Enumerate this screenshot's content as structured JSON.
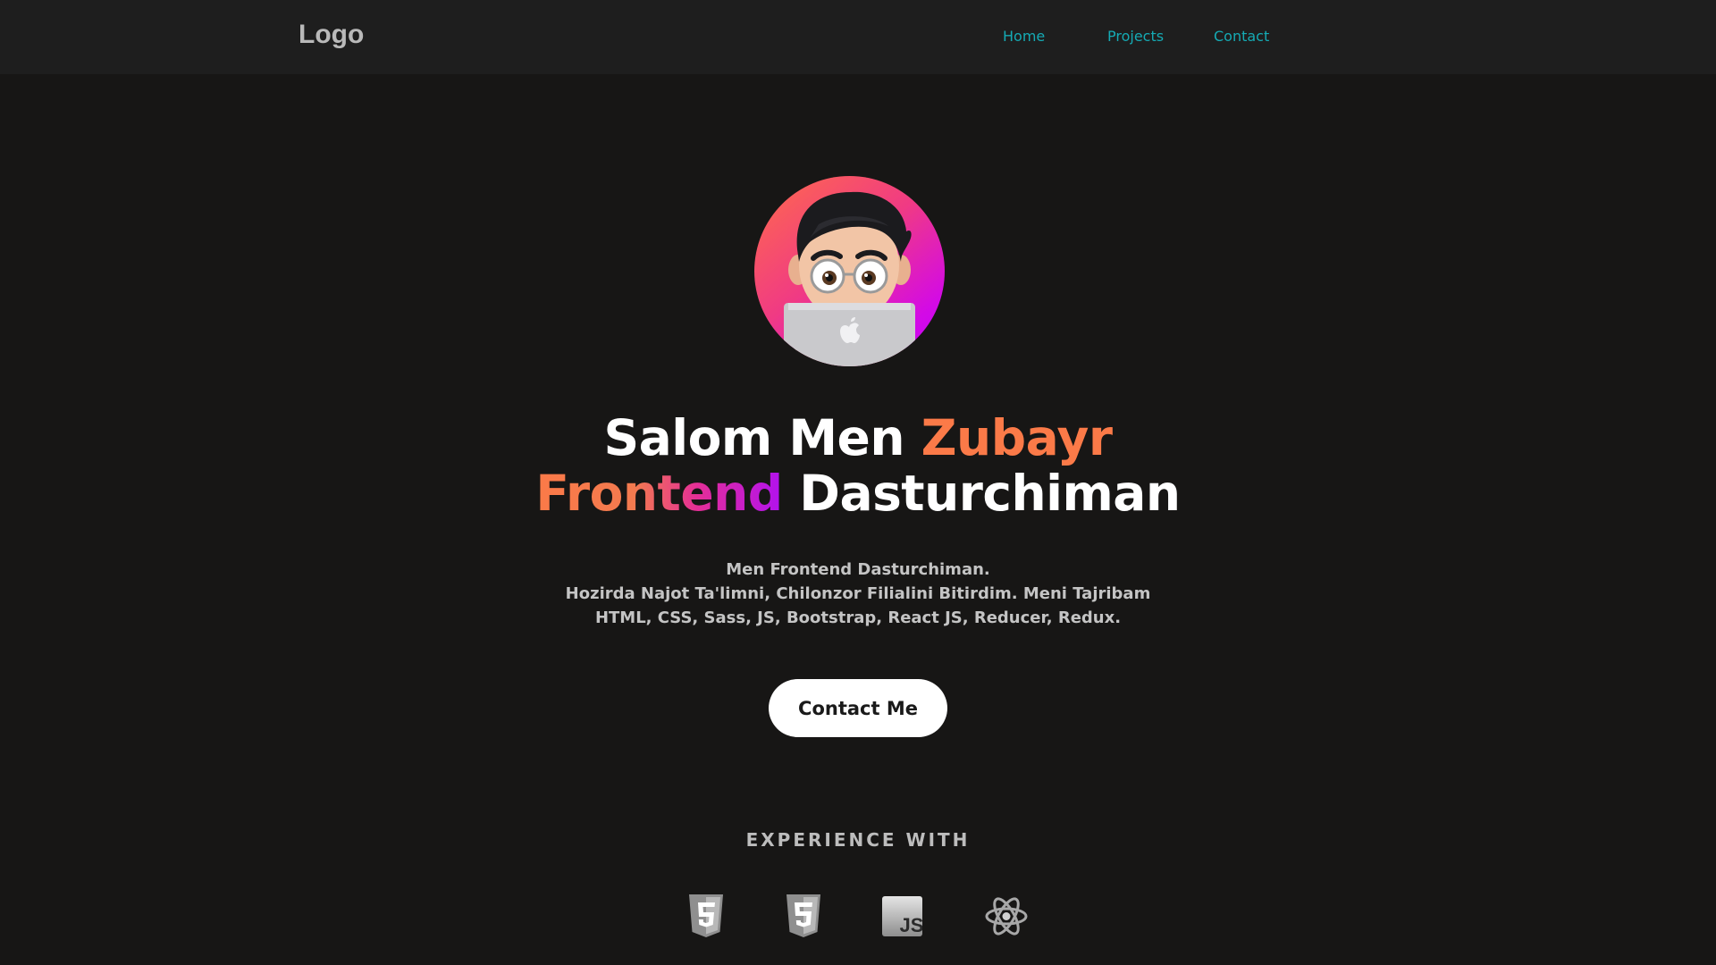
{
  "nav": {
    "logo": "Logo",
    "links": [
      {
        "label": "Home"
      },
      {
        "label": "Projects"
      },
      {
        "label": "Contact"
      }
    ],
    "link_color": "#15aab4"
  },
  "hero": {
    "avatar_icon": "memoji-avatar-laptop",
    "title_line1_a": "Salom Men ",
    "title_line1_b": "Zubayr",
    "title_line2_a": "Frontend",
    "title_line2_b": " Dasturchiman",
    "accent_color": "#fb7a48",
    "gradient_colors": [
      "#fb7a48",
      "#e52f96",
      "#b111f0"
    ],
    "description": [
      "Men Frontend Dasturchiman.",
      "Hozirda Najot Ta'limni, Chilonzor Filialini Bitirdim. Meni Tajribam",
      "HTML, CSS, Sass, JS, Bootstrap, React JS, Reducer, Redux."
    ],
    "cta_label": "Contact Me"
  },
  "experience": {
    "title": "EXPERIENCE WITH",
    "icons": [
      "html5-icon",
      "css3-icon",
      "javascript-icon",
      "react-icon"
    ]
  },
  "colors": {
    "background": "#171615",
    "navbar": "#1e1e1e"
  }
}
